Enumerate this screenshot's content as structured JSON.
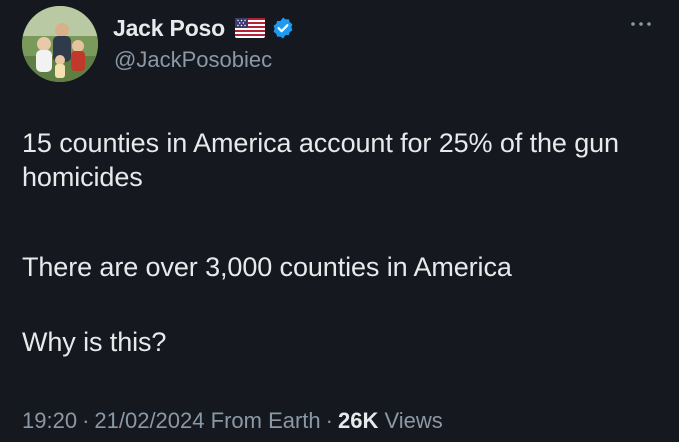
{
  "author": {
    "display_name": "Jack Poso",
    "flag_icon": "us-flag-icon",
    "verified_icon": "verified-badge-icon",
    "verified_color": "#1d9bf0",
    "handle": "@JackPosobiec"
  },
  "post": {
    "paragraphs": [
      "15 counties in America account for 25% of the gun homicides",
      "There are over 3,000 counties in America",
      "Why is this?"
    ]
  },
  "meta": {
    "time": "19:20",
    "date": "21/02/2024",
    "source": "From Earth",
    "separator": "·",
    "views_count": "26K",
    "views_label": "Views"
  },
  "colors": {
    "background": "#15181f",
    "primary_text": "#e7e9ea",
    "secondary_text": "#8b98a5"
  }
}
